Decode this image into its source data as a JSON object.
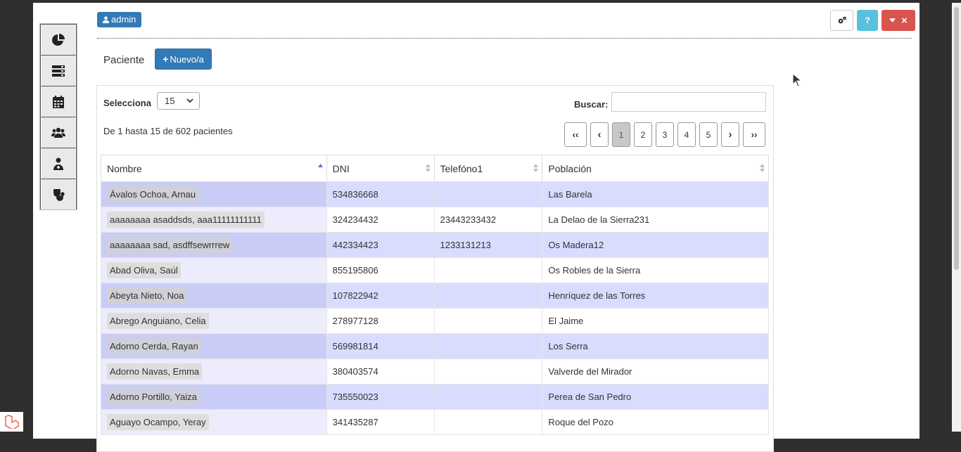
{
  "header": {
    "user_badge": "admin"
  },
  "toolbar": {
    "help_label": "?",
    "close_label": "×"
  },
  "section": {
    "title": "Paciente",
    "new_button": "Nuevo/a"
  },
  "controls": {
    "select_label": "Selecciona",
    "page_size": "15",
    "search_label": "Buscar:",
    "search_value": "",
    "info": "De 1 hasta 15 de 602 pacientes"
  },
  "pagination": {
    "first": "‹‹",
    "prev": "‹",
    "pages": [
      "1",
      "2",
      "3",
      "4",
      "5"
    ],
    "next": "›",
    "last": "››",
    "active": "1"
  },
  "table": {
    "headers": [
      "Nombre",
      "DNI",
      "Telefóno1",
      "Población"
    ],
    "rows": [
      [
        "Ávalos Ochoa, Arnau",
        "534836668",
        "",
        "Las Barela"
      ],
      [
        "aaaaaaaa asaddsds, aaa11111111111",
        "324234432",
        "23443233432",
        "La Delao de la Sierra231"
      ],
      [
        "aaaaaaaa sad, asdffsewrrrew",
        "442334423",
        "1233131213",
        "Os Madera12"
      ],
      [
        "Abad Oliva, Saúl",
        "855195806",
        "",
        "Os Robles de la Sierra"
      ],
      [
        "Abeyta Nieto, Noa",
        "107822942",
        "",
        "Henríquez de las Torres"
      ],
      [
        "Abrego Anguiano, Celia",
        "278977128",
        "",
        "El Jaime"
      ],
      [
        "Adorno Cerda, Rayan",
        "569981814",
        "",
        "Los Serra"
      ],
      [
        "Adorno Navas, Emma",
        "380403574",
        "",
        "Valverde del Mirador"
      ],
      [
        "Adorno Portillo, Yaiza",
        "735550023",
        "",
        "Perea de San Pedro"
      ],
      [
        "Aguayo Ocampo, Yeray",
        "341435287",
        "",
        "Roque del Pozo"
      ]
    ]
  },
  "colors": {
    "primary": "#337ab7",
    "info": "#5bc0de",
    "danger": "#d9534f",
    "row_odd": "#d9dcff"
  }
}
